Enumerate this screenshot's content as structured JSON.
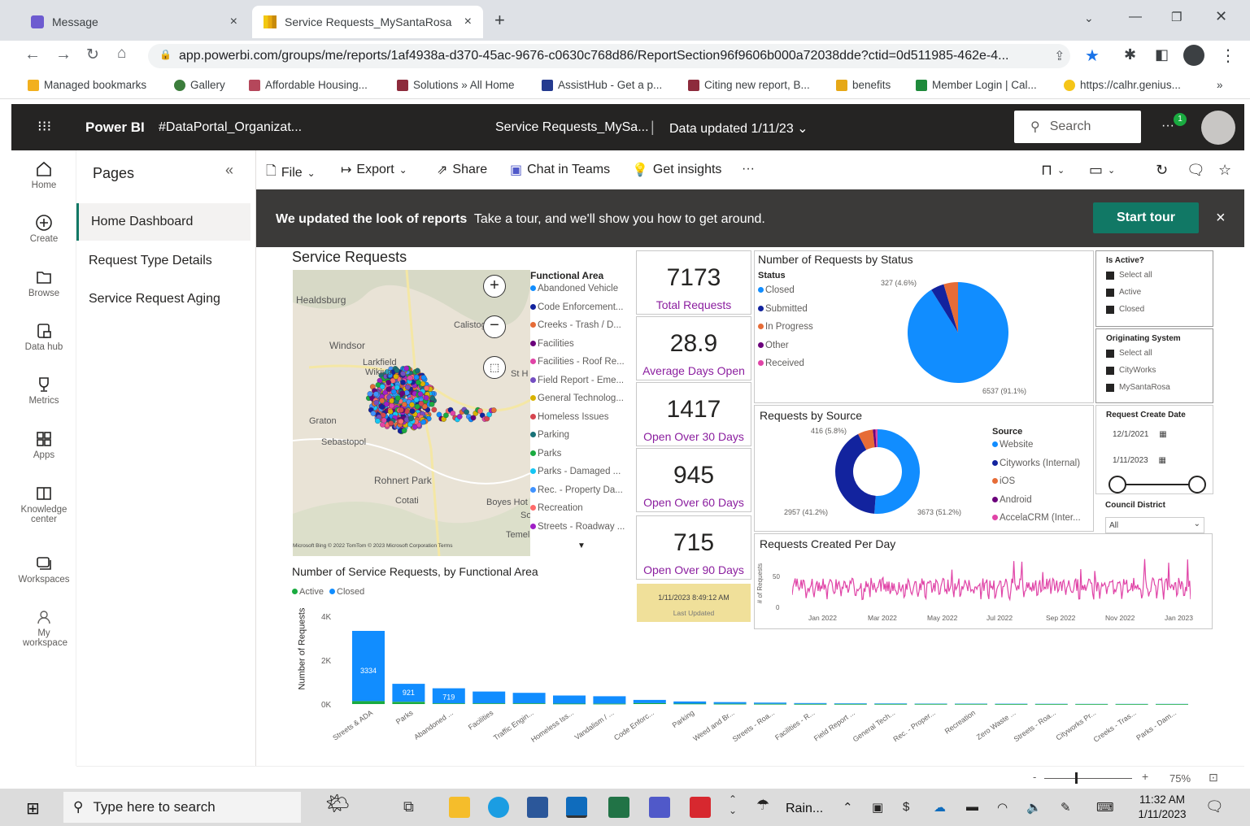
{
  "browser": {
    "tabs": [
      {
        "label": "Message",
        "close": "×"
      },
      {
        "label": "Service Requests_MySantaRosa",
        "close": "×"
      }
    ],
    "new_tab": "+",
    "url": "app.powerbi.com/groups/me/reports/1af4938a-d370-45ac-9676-c0630c768d86/ReportSection96f9606b000a72038dde?ctid=0d511985-462e-4...",
    "bookmarks": [
      {
        "label": "Managed bookmarks",
        "color": "#f2b01e"
      },
      {
        "label": "Gallery",
        "color": "#3c7d3c"
      },
      {
        "label": "Affordable Housing...",
        "color": "#b5475b"
      },
      {
        "label": "Solutions » All Home",
        "color": "#8d2b3c"
      },
      {
        "label": "AssistHub - Get a p...",
        "color": "#243a8f"
      },
      {
        "label": "Citing new report, B...",
        "color": "#8d2b3c"
      },
      {
        "label": "benefits",
        "color": "#e6a817"
      },
      {
        "label": "Member Login | Cal...",
        "color": "#1e8a3b"
      },
      {
        "label": "https://calhr.genius...",
        "color": "#f5c518"
      }
    ],
    "more": "»"
  },
  "header": {
    "app_name": "Power BI",
    "workspace": "#DataPortal_Organizat...",
    "report_name": "Service Requests_MySa...",
    "data_updated": "Data updated 1/11/23",
    "search_placeholder": "Search",
    "notification_count": "1"
  },
  "leftnav": [
    {
      "label": "Home",
      "icon": "home-icon"
    },
    {
      "label": "Create",
      "icon": "plus-circle-icon"
    },
    {
      "label": "Browse",
      "icon": "folder-icon"
    },
    {
      "label": "Data hub",
      "icon": "data-hub-icon"
    },
    {
      "label": "Metrics",
      "icon": "trophy-icon"
    },
    {
      "label": "Apps",
      "icon": "apps-icon"
    },
    {
      "label": "Knowledge center",
      "icon": "book-icon"
    },
    {
      "label": "Workspaces",
      "icon": "workspaces-icon"
    },
    {
      "label": "My workspace",
      "icon": "person-icon"
    }
  ],
  "pages": {
    "title": "Pages",
    "collapse": "«",
    "items": [
      "Home Dashboard",
      "Request Type Details",
      "Service Request Aging"
    ]
  },
  "toolbar": {
    "file": "File",
    "export": "Export",
    "share": "Share",
    "chat": "Chat in Teams",
    "insights": "Get insights",
    "more": "···"
  },
  "banner": {
    "bold": "We updated the look of reports",
    "text": "Take a tour, and we'll show you how to get around.",
    "button": "Start tour",
    "close": "×"
  },
  "map": {
    "title": "Service Requests",
    "places": [
      "Healdsburg",
      "Calistoga",
      "Windsor",
      "Larkfield",
      "Wikiup",
      "St H",
      "Graton",
      "Sebastopol",
      "Rohnert Park",
      "Cotati",
      "Boyes Hot",
      "So",
      "Temel"
    ],
    "copyright": "Microsoft Bing   © 2022 TomTom © 2023 Microsoft Corporation Terms",
    "legend_title": "Functional Area",
    "legend": [
      {
        "label": "Abandoned Vehicle",
        "color": "#118dff"
      },
      {
        "label": "Code Enforcement...",
        "color": "#12239e"
      },
      {
        "label": "Creeks - Trash / D...",
        "color": "#e66c37"
      },
      {
        "label": "Facilities",
        "color": "#6b007b"
      },
      {
        "label": "Facilities - Roof Re...",
        "color": "#e044a7"
      },
      {
        "label": "Field Report - Eme...",
        "color": "#744ec2"
      },
      {
        "label": "General Technolog...",
        "color": "#d9b300"
      },
      {
        "label": "Homeless Issues",
        "color": "#d64550"
      },
      {
        "label": "Parking",
        "color": "#197278"
      },
      {
        "label": "Parks",
        "color": "#1aab40"
      },
      {
        "label": "Parks - Damaged ...",
        "color": "#15c6f4"
      },
      {
        "label": "Rec. - Property Da...",
        "color": "#4092ff"
      },
      {
        "label": "Recreation",
        "color": "#ff6b6b"
      },
      {
        "label": "Streets - Roadway ...",
        "color": "#a01fc7"
      }
    ]
  },
  "kpis": [
    {
      "value": "7173",
      "label": "Total Requests"
    },
    {
      "value": "28.9",
      "label": "Average Days Open"
    },
    {
      "value": "1417",
      "label": "Open Over 30 Days"
    },
    {
      "value": "945",
      "label": "Open Over 60 Days"
    },
    {
      "value": "715",
      "label": "Open Over 90 Days"
    }
  ],
  "last_updated": {
    "value": "1/11/2023 8:49:12 AM",
    "label": "Last Updated"
  },
  "status_chart": {
    "title": "Number of Requests by Status",
    "legend_title": "Status",
    "legend": [
      {
        "label": "Closed",
        "color": "#118dff"
      },
      {
        "label": "Submitted",
        "color": "#12239e"
      },
      {
        "label": "In Progress",
        "color": "#e66c37"
      },
      {
        "label": "Other",
        "color": "#6b007b"
      },
      {
        "label": "Received",
        "color": "#e044a7"
      }
    ],
    "label_small": "327 (4.6%)",
    "label_large": "6537 (91.1%)"
  },
  "source_chart": {
    "title": "Requests by Source",
    "legend_title": "Source",
    "legend": [
      {
        "label": "Website",
        "color": "#118dff"
      },
      {
        "label": "Cityworks (Internal)",
        "color": "#12239e"
      },
      {
        "label": "iOS",
        "color": "#e66c37"
      },
      {
        "label": "Android",
        "color": "#6b007b"
      },
      {
        "label": "AccelaCRM (Inter...",
        "color": "#e044a7"
      }
    ],
    "label_top": "416 (5.8%)",
    "label_left": "2957 (41.2%)",
    "label_right": "3673 (51.2%)"
  },
  "slicers": {
    "active_title": "Is Active?",
    "active_options": [
      "Select all",
      "Active",
      "Closed"
    ],
    "system_title": "Originating System",
    "system_options": [
      "Select all",
      "CityWorks",
      "MySantaRosa"
    ],
    "date_title": "Request Create Date",
    "date_start": "12/1/2021",
    "date_end": "1/11/2023",
    "district_title": "Council District",
    "district_value": "All"
  },
  "per_day": {
    "title": "Requests Created Per Day",
    "ylabel": "# of Requests",
    "yticks": [
      "50",
      "0"
    ],
    "xticks": [
      "Jan 2022",
      "Mar 2022",
      "May 2022",
      "Jul 2022",
      "Sep 2022",
      "Nov 2022",
      "Jan 2023"
    ]
  },
  "chart_data": {
    "type": "bar",
    "title": "Number of Service Requests, by Functional Area",
    "ylabel": "Number of Requests",
    "xlabel": "",
    "ylim": [
      0,
      4000
    ],
    "yticks": [
      "4K",
      "2K",
      "0K"
    ],
    "categories": [
      "Streets & ADA",
      "Parks",
      "Abandoned ...",
      "Facilities",
      "Traffic Engin...",
      "Homeless Iss...",
      "Vandalism / ...",
      "Code Enforc...",
      "Parking",
      "Weed and Br...",
      "Streets - Roa...",
      "Facilities - R...",
      "Field Report ...",
      "General Tech...",
      "Rec. - Proper...",
      "Recreation",
      "Zero Waste ...",
      "Streets - Roa...",
      "Cityworks Pr...",
      "Creeks - Tras...",
      "Parks - Dam..."
    ],
    "series": [
      {
        "name": "Closed",
        "color": "#118dff",
        "values": [
          3200,
          820,
          690,
          540,
          480,
          370,
          340,
          150,
          100,
          80,
          60,
          40,
          30,
          25,
          20,
          15,
          12,
          10,
          8,
          6,
          5
        ]
      },
      {
        "name": "Active",
        "color": "#1aab40",
        "values": [
          134,
          101,
          29,
          30,
          30,
          20,
          15,
          40,
          20,
          10,
          8,
          5,
          3,
          3,
          2,
          2,
          1,
          1,
          1,
          1,
          1
        ]
      }
    ],
    "data_labels": [
      "3334",
      "921",
      "719"
    ],
    "legend": [
      "Active",
      "Closed"
    ]
  },
  "statusbar": {
    "zoom": "75%",
    "minus": "-",
    "plus": "+"
  },
  "taskbar": {
    "search_placeholder": "Type here to search",
    "weather": "Rain...",
    "time": "11:32 AM",
    "date": "1/11/2023"
  }
}
